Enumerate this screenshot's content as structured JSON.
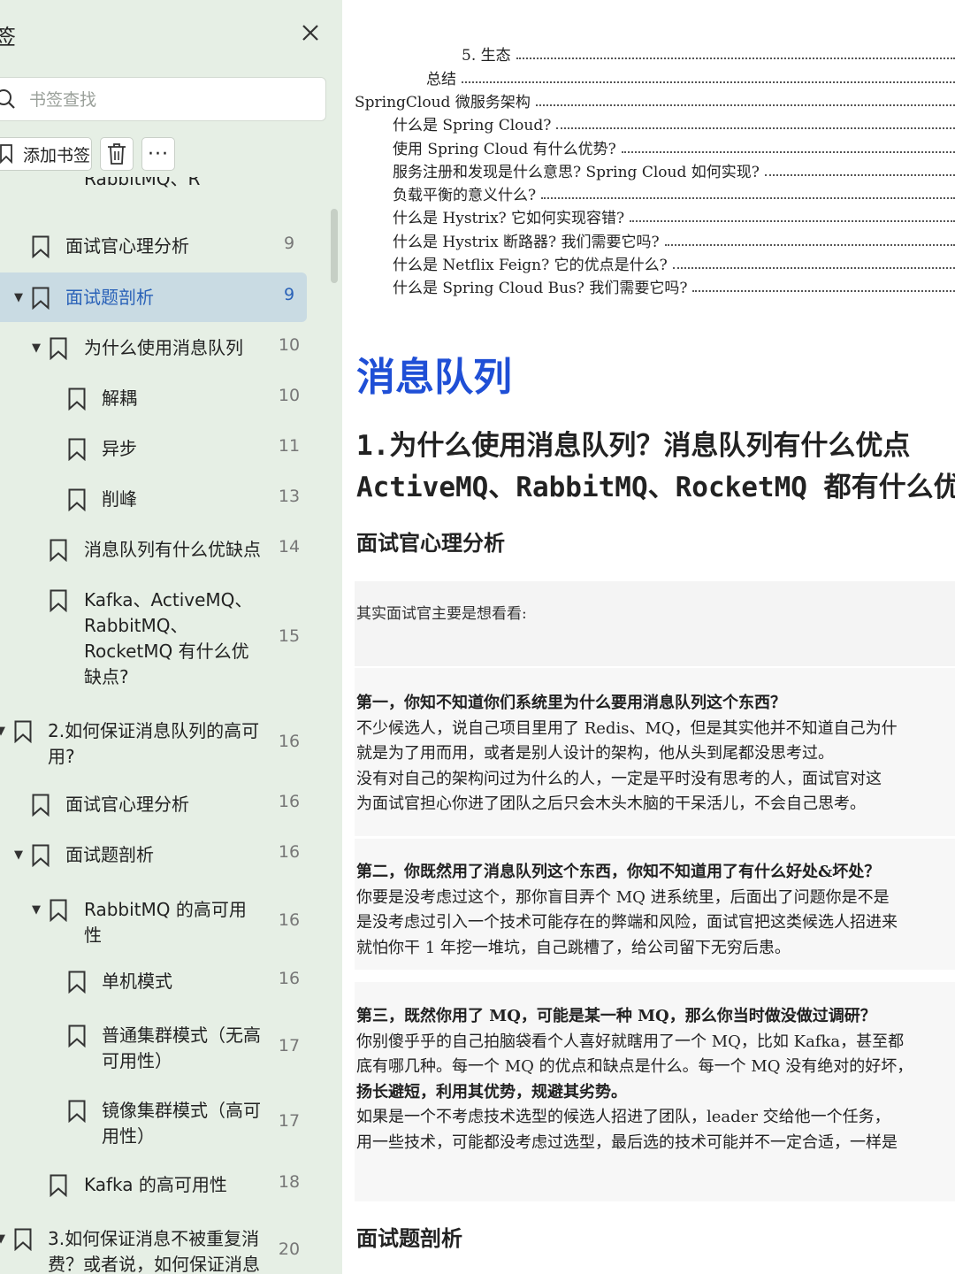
{
  "sidebar": {
    "title": "签",
    "search_placeholder": "书签查找",
    "add_label": "添加书签",
    "more_label": "···",
    "items": [
      {
        "label": "RabbitMQ、R",
        "page": ""
      },
      {
        "label": "面试官心理分析",
        "page": "9"
      },
      {
        "label": "面试题剖析",
        "page": "9"
      },
      {
        "label": "为什么使用消息队列",
        "page": "10"
      },
      {
        "label": "解耦",
        "page": "10"
      },
      {
        "label": "异步",
        "page": "11"
      },
      {
        "label": "削峰",
        "page": "13"
      },
      {
        "label": "消息队列有什么优缺点",
        "page": "14"
      },
      {
        "label": [
          "Kafka、ActiveMQ、",
          "RabbitMQ、",
          "RocketMQ 有什么优",
          "缺点?"
        ],
        "page": "15"
      },
      {
        "label": [
          "2.如何保证消息队列的高可",
          "用?"
        ],
        "page": "16"
      },
      {
        "label": "面试官心理分析",
        "page": "16"
      },
      {
        "label": "面试题剖析",
        "page": "16"
      },
      {
        "label": [
          "RabbitMQ 的高可用",
          "性"
        ],
        "page": "16"
      },
      {
        "label": "单机模式",
        "page": "16"
      },
      {
        "label": [
          "普通集群模式（无高",
          "可用性）"
        ],
        "page": "17"
      },
      {
        "label": [
          "镜像集群模式（高可",
          "用性）"
        ],
        "page": "17"
      },
      {
        "label": "Kafka 的高可用性",
        "page": "18"
      },
      {
        "label": [
          "3.如何保证消息不被重复消",
          "费？或者说，如何保证消息"
        ],
        "page": "20"
      }
    ]
  },
  "doc": {
    "toc_lines": [
      "5. 生态",
      "总结",
      "SpringCloud 微服务架构",
      "什么是 Spring Cloud?",
      "使用 Spring Cloud 有什么优势?",
      "服务注册和发现是什么意思? Spring Cloud 如何实现?",
      "负载平衡的意义什么?",
      "什么是 Hystrix? 它如何实现容错?",
      "什么是 Hystrix 断路器? 我们需要它吗?",
      "什么是 Netflix Feign? 它的优点是什么?",
      "什么是 Spring Cloud Bus? 我们需要它吗?"
    ],
    "section_title": "消息队列",
    "question_title": [
      "1.为什么使用消息队列？消息队列有什么优点",
      "ActiveMQ、RabbitMQ、RocketMQ 都有什么优"
    ],
    "heading_analysis": "面试官心理分析",
    "intro": "其实面试官主要是想看看:",
    "p1": [
      "第一，你知不知道你们系统里为什么要用消息队列这个东西？",
      " 不少候选人，说自己项目里用了 Redis、MQ，但是其实他并不知道自己为什",
      "就是为了用而用，或者是别人设计的架构，他从头到尾都没思考过。",
      " 没有对自己的架构问过为什么的人，一定是平时没有思考的人，面试官对这",
      "为面试官担心你进了团队之后只会木头木脑的干呆活儿，不会自己思考。"
    ],
    "p2": [
      "第二，你既然用了消息队列这个东西，你知不知道用了有什么好处&坏处？",
      " 你要是没考虑过这个，那你盲目弄个 MQ 进系统里，后面出了问题你是不是",
      "是没考虑过引入一个技术可能存在的弊端和风险，面试官把这类候选人招进来",
      "就怕你干 1 年挖一堆坑，自己跳槽了，给公司留下无穷后患。"
    ],
    "p3": [
      "第三，既然你用了 MQ，可能是某一种 MQ，那么你当时做没做过调研？",
      " 你别傻乎乎的自己拍脑袋看个人喜好就瞎用了一个 MQ，比如 Kafka，甚至都",
      "底有哪几种。每一个 MQ 的优点和缺点是什么。每一个 MQ 没有绝对的好坏，",
      "扬长避短，利用其优势，规避其劣势。",
      " 如果是一个不考虑技术选型的候选人招进了团队，leader 交给他一个任务，",
      "用一些技术，可能都没考虑过选型，最后选的技术可能并不一定合适，一样是"
    ],
    "heading_answer": "面试题剖析"
  },
  "colors": {
    "sidebar_bg": "#e6efe5",
    "selected_row_bg": "#c9dbe3",
    "selected_text": "#2a62b8",
    "section_title": "#1f4fd6"
  }
}
